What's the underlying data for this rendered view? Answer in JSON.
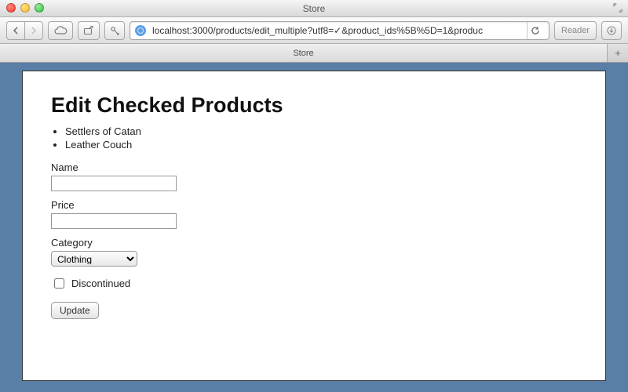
{
  "window": {
    "title": "Store"
  },
  "toolbar": {
    "url_full": "localhost:3000/products/edit_multiple?utf8=✓&product_ids%5B%5D=1&produc",
    "url_host": "localhost:3000",
    "url_path": "/products/edit_multiple?utf8=✓&product_ids%5B%5D=1&produc",
    "reader_label": "Reader"
  },
  "tab": {
    "title": "Store",
    "add_label": "+"
  },
  "content": {
    "heading": "Edit Checked Products",
    "product_items": [
      "Settlers of Catan",
      "Leather Couch"
    ],
    "name_label": "Name",
    "name_value": "",
    "price_label": "Price",
    "price_value": "",
    "category_label": "Category",
    "category_selected": "Clothing",
    "discontinued_label": "Discontinued",
    "discontinued_checked": false,
    "submit_label": "Update"
  }
}
